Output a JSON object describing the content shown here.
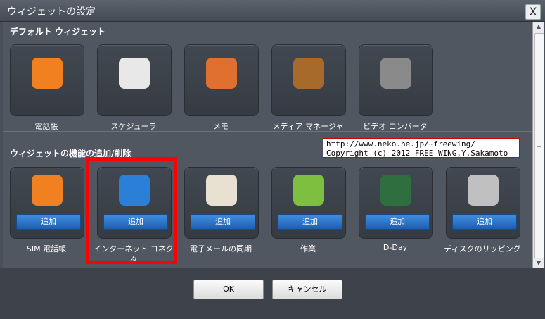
{
  "window": {
    "title": "ウィジェットの設定",
    "close_label": "X"
  },
  "sections": {
    "default": {
      "heading": "デフォルト ウィジェット",
      "widgets": [
        {
          "name": "電話帳",
          "icon": "phonebook-icon",
          "color": "#f08020"
        },
        {
          "name": "スケジューラ",
          "icon": "calendar-icon",
          "color": "#e8e8e8"
        },
        {
          "name": "メモ",
          "icon": "memo-icon",
          "color": "#e07030"
        },
        {
          "name": "メディア マネージャ",
          "icon": "media-manager-icon",
          "color": "#a86a2a"
        },
        {
          "name": "ビデオ コンバータ",
          "icon": "video-converter-icon",
          "color": "#8a8a8a"
        }
      ]
    },
    "optional": {
      "heading": "ウィジェットの機能の追加/削除",
      "add_label": "追加",
      "widgets": [
        {
          "name": "SIM 電話帳",
          "icon": "sim-phonebook-icon",
          "color": "#f08020"
        },
        {
          "name": "インターネット コネクタ",
          "icon": "internet-connector-icon",
          "color": "#2a7fd6"
        },
        {
          "name": "電子メールの同期",
          "icon": "email-sync-icon",
          "color": "#e8e0d0"
        },
        {
          "name": "作業",
          "icon": "tasks-icon",
          "color": "#7fbf3f"
        },
        {
          "name": "D-Day",
          "icon": "d-day-icon",
          "color": "#2f6f3f"
        },
        {
          "name": "ディスクのリッピング",
          "icon": "disc-ripping-icon",
          "color": "#c0c0c0"
        }
      ]
    }
  },
  "watermark": {
    "line1": "http://www.neko.ne.jp/~freewing/",
    "line2": "Copyright (c) 2012 FREE WING,Y.Sakamoto"
  },
  "footer": {
    "ok_label": "OK",
    "cancel_label": "キャンセル"
  },
  "colors": {
    "highlight": "#ff0000",
    "add_button": "#2a74cc"
  }
}
